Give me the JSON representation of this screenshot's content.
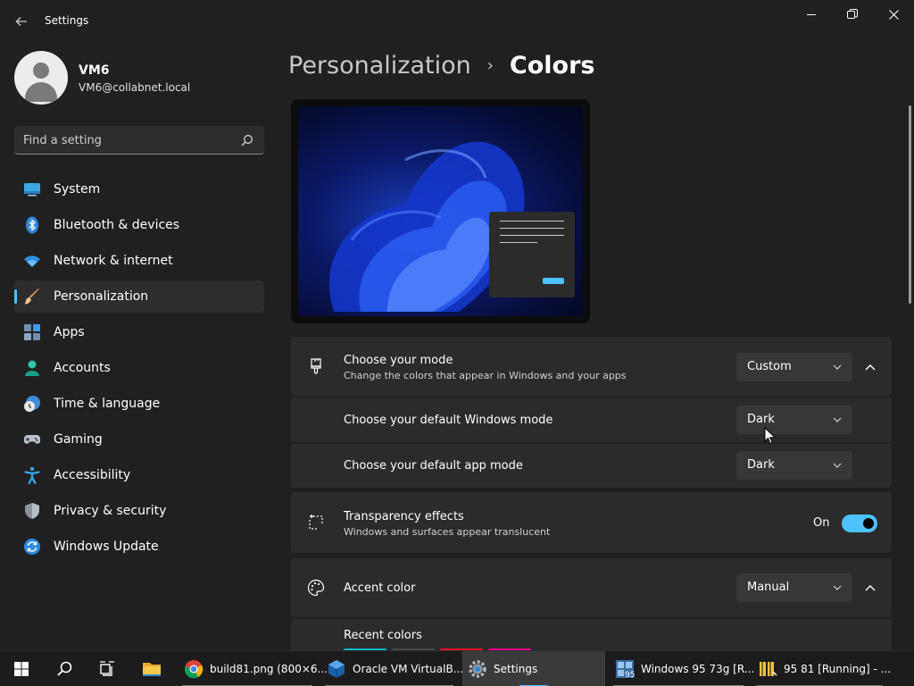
{
  "window": {
    "title": "Settings"
  },
  "profile": {
    "name": "VM6",
    "email": "VM6@collabnet.local"
  },
  "search": {
    "placeholder": "Find a setting"
  },
  "sidebar": {
    "items": [
      {
        "label": "System",
        "icon": "system-icon"
      },
      {
        "label": "Bluetooth & devices",
        "icon": "bluetooth-icon"
      },
      {
        "label": "Network & internet",
        "icon": "wifi-icon"
      },
      {
        "label": "Personalization",
        "icon": "brush-icon",
        "active": true
      },
      {
        "label": "Apps",
        "icon": "apps-icon"
      },
      {
        "label": "Accounts",
        "icon": "accounts-icon"
      },
      {
        "label": "Time & language",
        "icon": "time-language-icon"
      },
      {
        "label": "Gaming",
        "icon": "gamepad-icon"
      },
      {
        "label": "Accessibility",
        "icon": "accessibility-icon"
      },
      {
        "label": "Privacy & security",
        "icon": "shield-icon"
      },
      {
        "label": "Windows Update",
        "icon": "windows-update-icon"
      }
    ]
  },
  "breadcrumb": {
    "parent": "Personalization",
    "separator": "›",
    "current": "Colors"
  },
  "mode": {
    "title": "Choose your mode",
    "description": "Change the colors that appear in Windows and your apps",
    "value": "Custom",
    "windows_mode_label": "Choose your default Windows mode",
    "windows_mode_value": "Dark",
    "app_mode_label": "Choose your default app mode",
    "app_mode_value": "Dark"
  },
  "transparency": {
    "title": "Transparency effects",
    "description": "Windows and surfaces appear translucent",
    "state_label": "On",
    "enabled": true
  },
  "accent": {
    "title": "Accent color",
    "value": "Manual",
    "recent_colors_label": "Recent colors",
    "recent_colors": [
      "#00b7c3",
      "#4a4a4a",
      "#e81123",
      "#e3008c"
    ]
  },
  "taskbar": {
    "apps": [
      {
        "label": "build81.png (800×6...",
        "icon": "chrome-icon"
      },
      {
        "label": "Oracle VM VirtualB...",
        "icon": "virtualbox-icon"
      },
      {
        "label": "Settings",
        "icon": "settings-gear-icon",
        "active": true
      },
      {
        "label": "Windows 95 73g [R...",
        "icon": "windows95-vm-icon"
      },
      {
        "label": "95 81 [Running] - ...",
        "icon": "vm-running-icon"
      }
    ]
  },
  "colors": {
    "accent": "#4cc2ff",
    "background": "#202020",
    "card": "#2b2b2b"
  }
}
